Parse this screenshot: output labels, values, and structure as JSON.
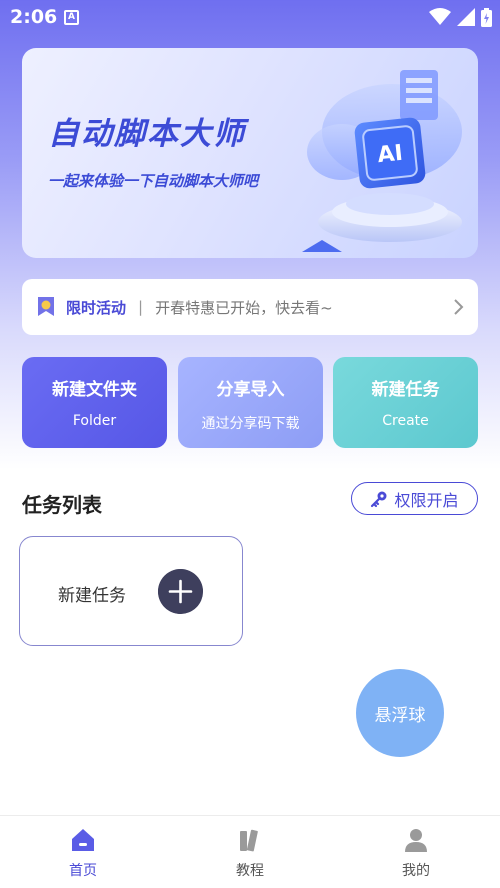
{
  "status_bar": {
    "time": "2:06",
    "notification_badge": "A"
  },
  "banner": {
    "title": "自动脚本大师",
    "subtitle": "一起来体验一下自动脚本大师吧",
    "art_label": "AI"
  },
  "activity": {
    "title": "限时活动",
    "separator": "|",
    "text": "开春特惠已开始，快去看~"
  },
  "quick_actions": [
    {
      "title": "新建文件夹",
      "subtitle": "Folder"
    },
    {
      "title": "分享导入",
      "subtitle": "通过分享码下载"
    },
    {
      "title": "新建任务",
      "subtitle": "Create"
    }
  ],
  "task_list": {
    "title": "任务列表",
    "permission_button": "权限开启",
    "new_task_label": "新建任务"
  },
  "floating_ball": {
    "label": "悬浮球"
  },
  "bottom_nav": [
    {
      "label": "首页",
      "icon": "home-icon",
      "active": true
    },
    {
      "label": "教程",
      "icon": "book-icon",
      "active": false
    },
    {
      "label": "我的",
      "icon": "user-icon",
      "active": false
    }
  ],
  "colors": {
    "accent": "#4a4ad6",
    "card_folder": "#5f61ee",
    "card_share": "#97a7fa",
    "card_create": "#66cfd5",
    "floating_ball": "#7fb2f5"
  }
}
